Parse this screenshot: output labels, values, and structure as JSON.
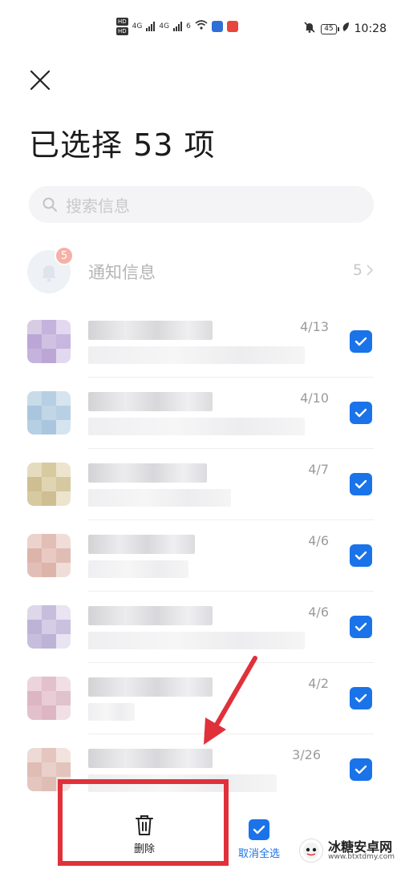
{
  "status_bar": {
    "hd1": "HD",
    "hd2": "HD",
    "net1": "4G",
    "net2": "4G",
    "wifi_tag": "6",
    "battery": "45",
    "time": "10:28"
  },
  "header": {
    "title": "已选择 53 项"
  },
  "search": {
    "placeholder": "搜索信息"
  },
  "notifications": {
    "label": "通知信息",
    "badge": "5",
    "count": "5"
  },
  "messages": [
    {
      "date": "4/13",
      "checked": true,
      "tint": [
        "#d7cce4",
        "#c4b3dc",
        "#e2d8ef",
        "#bca6d6",
        "#d0c1e3",
        "#c7b6de"
      ]
    },
    {
      "date": "4/10",
      "checked": true,
      "tint": [
        "#c8dbe9",
        "#b6cfe3",
        "#d6e4ef",
        "#aac6de",
        "#c1d6e7",
        "#b8d0e4"
      ]
    },
    {
      "date": "4/7",
      "checked": true,
      "tint": [
        "#e5dcc0",
        "#d7caa0",
        "#ece4cc",
        "#cfbe92",
        "#e0d5b3",
        "#d6c89f"
      ]
    },
    {
      "date": "4/6",
      "checked": true,
      "tint": [
        "#ecd2cc",
        "#e2bfb6",
        "#f1ddd8",
        "#ddb4aa",
        "#e8cac2",
        "#e0bdb4"
      ]
    },
    {
      "date": "4/6",
      "checked": true,
      "tint": [
        "#ddd7ea",
        "#c6bedc",
        "#e8e4f1",
        "#bdb3d6",
        "#d4cde6",
        "#c9c1de"
      ]
    },
    {
      "date": "4/2",
      "checked": true,
      "tint": [
        "#ecd4dc",
        "#e2c0cc",
        "#f1dfe5",
        "#ddb6c4",
        "#e8cdd6",
        "#e0c2cd"
      ]
    },
    {
      "date": "3/26",
      "checked": true,
      "tint": [
        "#eed9d4",
        "#e4c6bf",
        "#f3e3df",
        "#dfbdb4",
        "#ead0ca",
        "#e2c4bc"
      ]
    }
  ],
  "bottom_bar": {
    "delete_label": "删除",
    "deselect_label": "取消全选"
  },
  "watermark": {
    "name": "冰糖安卓网",
    "url": "www.btxtdmy.com"
  },
  "colors": {
    "accent": "#1a73e8",
    "annotation": "#e0313b"
  }
}
